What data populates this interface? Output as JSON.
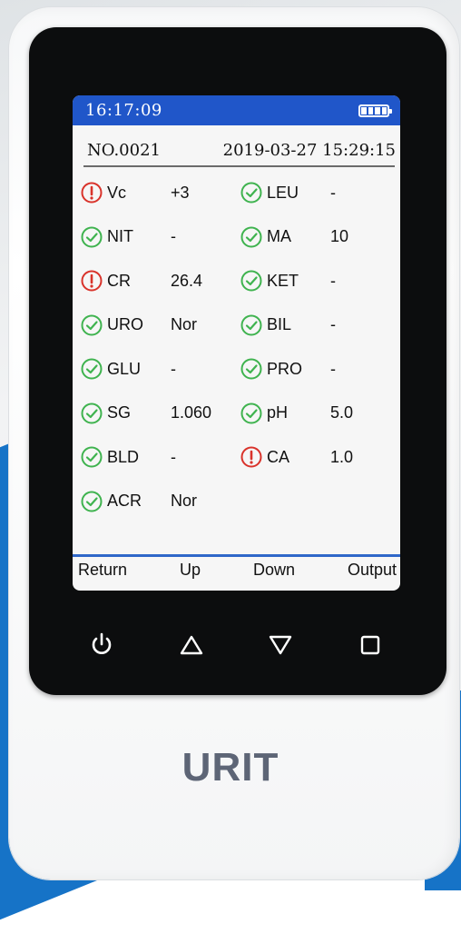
{
  "screen": {
    "clock": "16:17:09",
    "record_no": "NO.0021",
    "record_datetime": "2019-03-27 15:29:15",
    "results": [
      {
        "label": "Vc",
        "value": "+3",
        "status": "abnormal"
      },
      {
        "label": "LEU",
        "value": "-",
        "status": "normal"
      },
      {
        "label": "NIT",
        "value": "-",
        "status": "normal"
      },
      {
        "label": "MA",
        "value": "10",
        "status": "normal"
      },
      {
        "label": "CR",
        "value": "26.4",
        "status": "abnormal"
      },
      {
        "label": "KET",
        "value": "-",
        "status": "normal"
      },
      {
        "label": "URO",
        "value": "Nor",
        "status": "normal"
      },
      {
        "label": "BIL",
        "value": "-",
        "status": "normal"
      },
      {
        "label": "GLU",
        "value": "-",
        "status": "normal"
      },
      {
        "label": "PRO",
        "value": "-",
        "status": "normal"
      },
      {
        "label": "SG",
        "value": "1.060",
        "status": "normal"
      },
      {
        "label": "pH",
        "value": "5.0",
        "status": "normal"
      },
      {
        "label": "BLD",
        "value": "-",
        "status": "normal"
      },
      {
        "label": "CA",
        "value": "1.0",
        "status": "abnormal"
      },
      {
        "label": "ACR",
        "value": "Nor",
        "status": "normal"
      }
    ],
    "softkeys": {
      "return": "Return",
      "up": "Up",
      "down": "Down",
      "output": "Output"
    }
  },
  "hardware_buttons": [
    "power-icon",
    "triangle-up-icon",
    "triangle-down-icon",
    "square-icon"
  ],
  "brand": "URIT",
  "colors": {
    "status_bar": "#2056c9",
    "normal_icon": "#3fb34f",
    "abnormal_icon": "#d9332b",
    "brand_text": "#5d6576",
    "background_accent": "#1673c7"
  }
}
